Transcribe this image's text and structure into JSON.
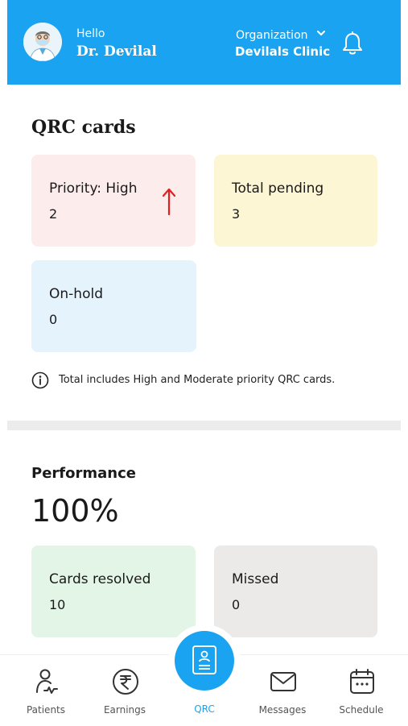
{
  "header": {
    "greeting": "Hello",
    "doctor_name": "Dr. Devilal",
    "org_label": "Organization",
    "org_name": "Devilals Clinic",
    "background": "#1aa3f0"
  },
  "qrc": {
    "title": "QRC cards",
    "cards": [
      {
        "label": "Priority: High",
        "value": "2",
        "color": "#fdecec",
        "indicator": "up-arrow (red)"
      },
      {
        "label": "Total pending",
        "value": "3",
        "color": "#fdf6d4"
      },
      {
        "label": "On-hold",
        "value": "0",
        "color": "#e5f3fd"
      }
    ],
    "note": "Total includes High and Moderate priority QRC cards."
  },
  "performance": {
    "label": "Performance",
    "value": "100%",
    "cards": [
      {
        "label": "Cards resolved",
        "value": "10",
        "color": "#e2f5e6"
      },
      {
        "label": "Missed",
        "value": "0",
        "color": "#ece9e9"
      }
    ]
  },
  "nav": {
    "items": [
      {
        "label": "Patients",
        "icon": "patient-icon"
      },
      {
        "label": "Earnings",
        "icon": "rupee-icon"
      },
      {
        "label": "QRC",
        "icon": "qrc-card-icon",
        "active": true
      },
      {
        "label": "Messages",
        "icon": "mail-icon"
      },
      {
        "label": "Schedule",
        "icon": "calendar-icon"
      }
    ],
    "active_color": "#1aa3f0"
  }
}
